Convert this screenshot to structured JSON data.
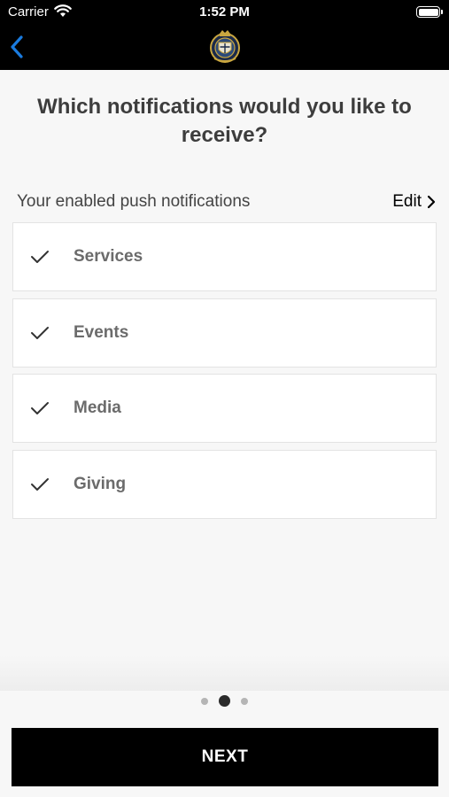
{
  "status_bar": {
    "carrier": "Carrier",
    "time": "1:52 PM"
  },
  "nav": {
    "back_icon": "chevron-left-icon",
    "logo_icon": "crest-logo-icon"
  },
  "heading": "Which notifications would you like to receive?",
  "section": {
    "label": "Your enabled push notifications",
    "edit": "Edit"
  },
  "items": [
    {
      "label": "Services",
      "checked": true
    },
    {
      "label": "Events",
      "checked": true
    },
    {
      "label": "Media",
      "checked": true
    },
    {
      "label": "Giving",
      "checked": true
    }
  ],
  "pager": {
    "count": 3,
    "active": 2
  },
  "next_label": "NEXT",
  "colors": {
    "accent_blue": "#1a7bdf",
    "button_bg": "#000000"
  }
}
